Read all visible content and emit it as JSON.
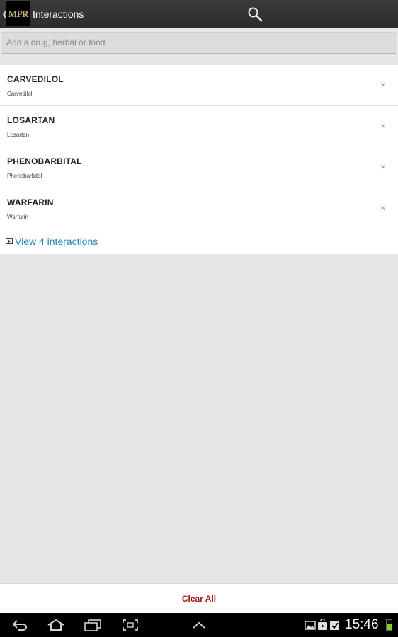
{
  "app": {
    "logo_text": "MPR",
    "title": "Interactions",
    "colors": {
      "actionbar": "#2f2f2f",
      "link": "#1d86b8",
      "clear": "#a01c12"
    }
  },
  "search": {
    "icon": "search-icon",
    "value": ""
  },
  "add_field": {
    "placeholder": "Add a drug, herbal or food",
    "value": ""
  },
  "drugs": [
    {
      "name": "CARVEDILOL",
      "generic": "Carvedilol"
    },
    {
      "name": "LOSARTAN",
      "generic": "Losartan"
    },
    {
      "name": "PHENOBARBITAL",
      "generic": "Phenobarbital"
    },
    {
      "name": "WARFARIN",
      "generic": "Warfarin"
    }
  ],
  "remove_glyph": "×",
  "view_interactions": {
    "label": "View 4 interactions",
    "icon": "play-box-icon"
  },
  "clear_all": {
    "label": "Clear All"
  },
  "system_bar": {
    "time": "15:46",
    "icons": [
      "back-icon",
      "home-icon",
      "recent-apps-icon",
      "screenshot-icon",
      "chevron-up-icon",
      "gallery-icon",
      "play-store-icon",
      "download-done-icon",
      "battery-icon"
    ]
  }
}
